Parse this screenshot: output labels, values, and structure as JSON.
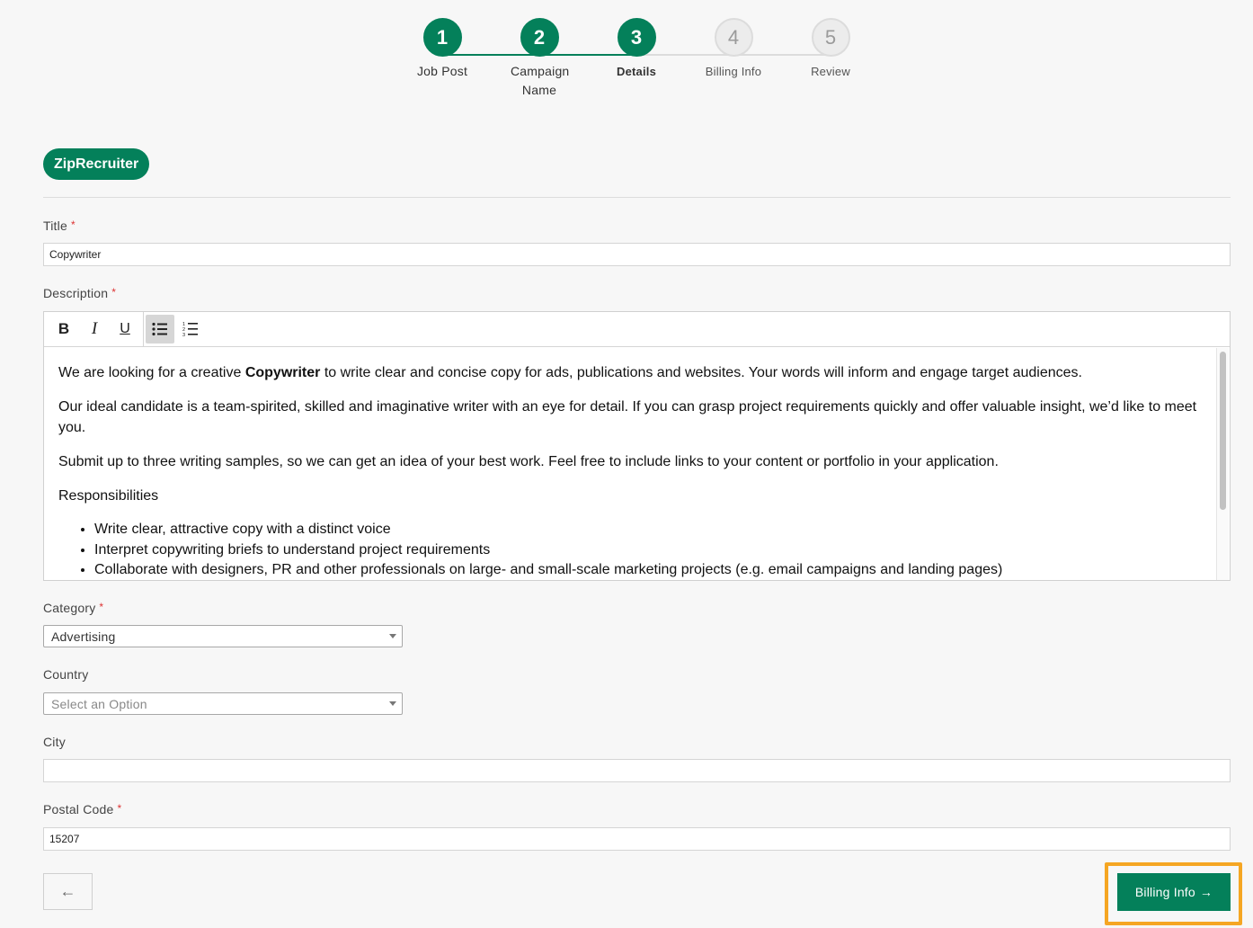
{
  "stepper": {
    "steps": [
      {
        "number": "1",
        "label": "Job Post",
        "state": "done"
      },
      {
        "number": "2",
        "label": "Campaign Name",
        "state": "done"
      },
      {
        "number": "3",
        "label": "Details",
        "state": "current"
      },
      {
        "number": "4",
        "label": "Billing Info",
        "state": "todo"
      },
      {
        "number": "5",
        "label": "Review",
        "state": "todo"
      }
    ]
  },
  "brand": {
    "name": "ZipRecruiter",
    "color": "#04805a"
  },
  "form": {
    "title": {
      "label": "Title",
      "required": "*",
      "value": "Copywriter"
    },
    "description": {
      "label": "Description",
      "required": "*",
      "toolbar": {
        "bold_icon": "B",
        "italic_icon": "I",
        "underline_icon": "U",
        "bullet_list_icon": "bullet-list-icon",
        "numbered_list_icon": "numbered-list-icon"
      },
      "p1_before": "We are looking for a creative ",
      "p1_bold": "Copywriter",
      "p1_after": " to write clear and concise copy for ads, publications and websites. Your words will inform and engage target audiences.",
      "p2": "Our ideal candidate is a team-spirited, skilled and imaginative writer with an eye for detail. If you can grasp project requirements quickly and offer valuable insight, we’d like to meet you.",
      "p3": "Submit up to three writing samples, so we can get an idea of your best work. Feel free to include links to your content or portfolio in your application.",
      "p4": "Responsibilities",
      "bullets": [
        "Write clear, attractive copy with a distinct voice",
        "Interpret copywriting briefs to understand project requirements",
        "Collaborate with designers, PR and other professionals on large- and small-scale marketing projects (e.g. email campaigns and landing pages)"
      ]
    },
    "category": {
      "label": "Category",
      "required": "*",
      "value": "Advertising"
    },
    "country": {
      "label": "Country",
      "placeholder": "Select an Option"
    },
    "city": {
      "label": "City",
      "value": ""
    },
    "postal_code": {
      "label": "Postal Code",
      "required": "*",
      "value": "15207"
    }
  },
  "footer": {
    "back_icon": "←",
    "next_label": "Billing Info",
    "next_icon": "→",
    "highlight_color": "#f5a623"
  }
}
